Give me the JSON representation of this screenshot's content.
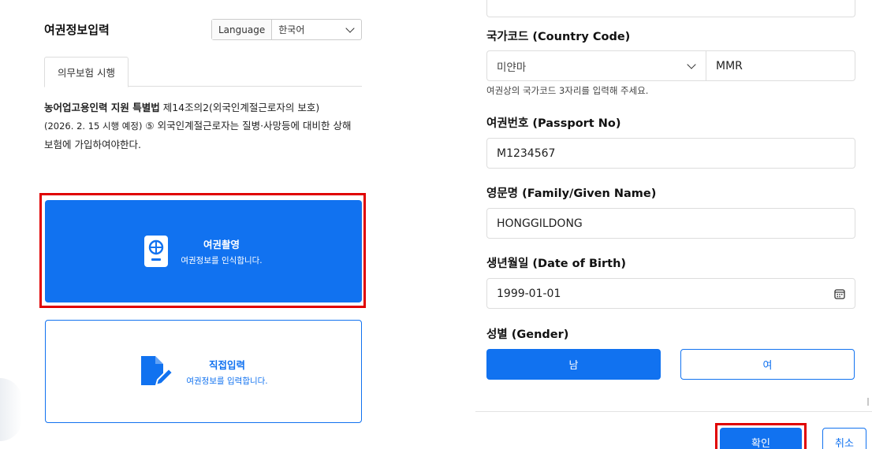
{
  "left": {
    "title": "여권정보입력",
    "language_label": "Language",
    "language_value": "한국어",
    "tab": "의무보험 시행",
    "law_bold": "농어업고용인력 지원 특별법",
    "law_text1": " 제14조의2(외국인계절근로자의 보호)",
    "law_text2_small": "(2026. 2. 15 시행 예정)",
    "law_text2": " ⑤ 외국인계절근로자는 질병·사망등에 대비한 상해",
    "law_text3": "보험에 가입하여야한다.",
    "card_scan": {
      "title": "여권촬영",
      "subtitle": "여권정보를 인식합니다."
    },
    "card_manual": {
      "title": "직접입력",
      "subtitle": "여권정보를 입력합니다."
    }
  },
  "right": {
    "country_label": "국가코드 (Country Code)",
    "country_select": "미얀마",
    "country_code": "MMR",
    "country_hint": "여권상의 국가코드 3자리를 입력해 주세요.",
    "passport_label": "여권번호 (Passport No)",
    "passport_value": "M1234567",
    "name_label": "영문명 (Family/Given Name)",
    "name_value": "HONGGILDONG",
    "dob_label": "생년월일 (Date of Birth)",
    "dob_value": "1999-01-01",
    "gender_label": "성별 (Gender)",
    "gender_male": "남",
    "gender_female": "여",
    "confirm": "확인",
    "cancel": "취소"
  },
  "colors": {
    "primary": "#1172f0",
    "highlight": "#e00000"
  }
}
